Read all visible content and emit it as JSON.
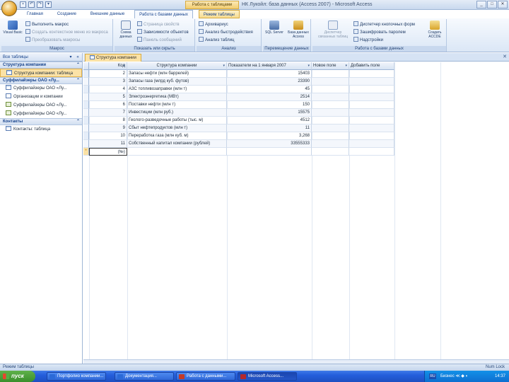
{
  "window": {
    "title": "НК Лукойл: база данных (Access 2007) - Microsoft Access",
    "context_tab_title": "Работа с таблицами",
    "controls": [
      "_",
      "□",
      "✕"
    ]
  },
  "quick_access": [
    "save-icon",
    "undo-icon",
    "redo-icon",
    "customize-icon"
  ],
  "tabs": [
    {
      "label": "Главная",
      "active": false
    },
    {
      "label": "Создание",
      "active": false
    },
    {
      "label": "Внешние данные",
      "active": false
    },
    {
      "label": "Работа с базами данных",
      "active": true
    },
    {
      "label": "Режим таблицы",
      "active": false,
      "context": true
    }
  ],
  "ribbon": {
    "groups": [
      {
        "label": "Макрос",
        "big": [
          {
            "label": "Visual Basic",
            "icon": "visual-basic-icon"
          }
        ],
        "small": [
          {
            "label": "Выполнить макрос",
            "dim": false
          },
          {
            "label": "Создать контекстное меню из макроса",
            "dim": true
          },
          {
            "label": "Преобразовать макросы",
            "dim": true
          }
        ]
      },
      {
        "label": "Показать или скрыть",
        "big": [
          {
            "label": "Схема данных",
            "icon": "relationships-icon"
          }
        ],
        "small": [
          {
            "label": "Страница свойств",
            "dim": true
          },
          {
            "label": "Зависимости объектов",
            "dim": false
          },
          {
            "label": "Панель сообщений",
            "dim": true
          }
        ]
      },
      {
        "label": "Анализ",
        "small": [
          {
            "label": "Архивариус",
            "dim": false
          },
          {
            "label": "Анализ быстродействия",
            "dim": false
          },
          {
            "label": "Анализ таблиц",
            "dim": false
          }
        ]
      },
      {
        "label": "Перемещение данных",
        "big": [
          {
            "label": "SQL Server",
            "icon": "sql-server-icon"
          },
          {
            "label": "База данных Access",
            "icon": "split-database-icon"
          }
        ]
      },
      {
        "label": "Работа с базами данных",
        "big": [
          {
            "label": "Диспетчер связанных таблиц",
            "icon": "linked-table-manager-icon"
          },
          {
            "label": "Создать ACCDE",
            "icon": "make-accde-icon"
          }
        ],
        "small": [
          {
            "label": "Диспетчер кнопочных форм",
            "dim": false
          },
          {
            "label": "Зашифровать паролем",
            "dim": false
          },
          {
            "label": "Надстройки",
            "dim": false
          }
        ]
      }
    ]
  },
  "nav": {
    "header": "Все таблицы",
    "groups": [
      {
        "label": "Структура компании",
        "items": [
          {
            "label": "Структура компании: таблица",
            "type": "table",
            "selected": true
          }
        ]
      },
      {
        "label": "Суффилайзеры ОАО «Лу...",
        "items": [
          {
            "label": "Суффилайзеры ОАО «Лу...",
            "type": "table",
            "selected": false
          },
          {
            "label": "Организации и компании",
            "type": "query",
            "selected": false
          },
          {
            "label": "Суффилайзеры ОАО «Лу...",
            "type": "form",
            "selected": false
          },
          {
            "label": "Суффилайзеры ОАО «Лу...",
            "type": "form",
            "selected": false
          }
        ]
      },
      {
        "label": "Контакты",
        "items": [
          {
            "label": "Контакты: таблица",
            "type": "table",
            "selected": false
          }
        ]
      }
    ]
  },
  "document": {
    "tab_label": "Структура компании",
    "columns": [
      "Код",
      "Структура компании",
      "Показатели на 1 января 2007",
      "Новое поле",
      "Добавить поле"
    ],
    "rows": [
      {
        "code": "2",
        "struct": "Запасы нефти (млн баррелей)",
        "value": "15403"
      },
      {
        "code": "3",
        "struct": "Запасы газа (млрд куб. футов)",
        "value": "23390"
      },
      {
        "code": "4",
        "struct": "АЗС топливозаправки (млн т)",
        "value": "45"
      },
      {
        "code": "5",
        "struct": "Электроэнергетика (МВт)",
        "value": "2514"
      },
      {
        "code": "6",
        "struct": "Поставки нефти (млн т)",
        "value": "150"
      },
      {
        "code": "7",
        "struct": "Инвестиции (млн руб.)",
        "value": "15575"
      },
      {
        "code": "8",
        "struct": "Геолого-разведочные работы (тыс. м)",
        "value": "4512"
      },
      {
        "code": "9",
        "struct": "Сбыт нефтепродуктов (млн т)",
        "value": "11"
      },
      {
        "code": "10",
        "struct": "Переработка газа (млн куб. м)",
        "value": "3,268"
      },
      {
        "code": "11",
        "struct": "Собственный капитал компании (рублей)",
        "value": "33555333"
      }
    ],
    "new_row": {
      "code": "(№)",
      "marker": "*"
    }
  },
  "status": {
    "left": "Режим таблицы",
    "right": "Num Lock"
  },
  "taskbar": {
    "start_label": "пуск",
    "tasks": [
      {
        "label": "Портфолио компании...",
        "active": false,
        "color": "#2b6ad8"
      },
      {
        "label": "Документация...",
        "active": false,
        "color": "#2b6ad8"
      },
      {
        "label": "Работа с данными...",
        "active": false,
        "color": "#c43a28"
      },
      {
        "label": "Microsoft Access...",
        "active": true,
        "color": "#b3282d"
      }
    ],
    "tray": {
      "lang": "RU",
      "icons": "Бизнес ≪ ◆ ◐",
      "clock": "14:37"
    }
  }
}
